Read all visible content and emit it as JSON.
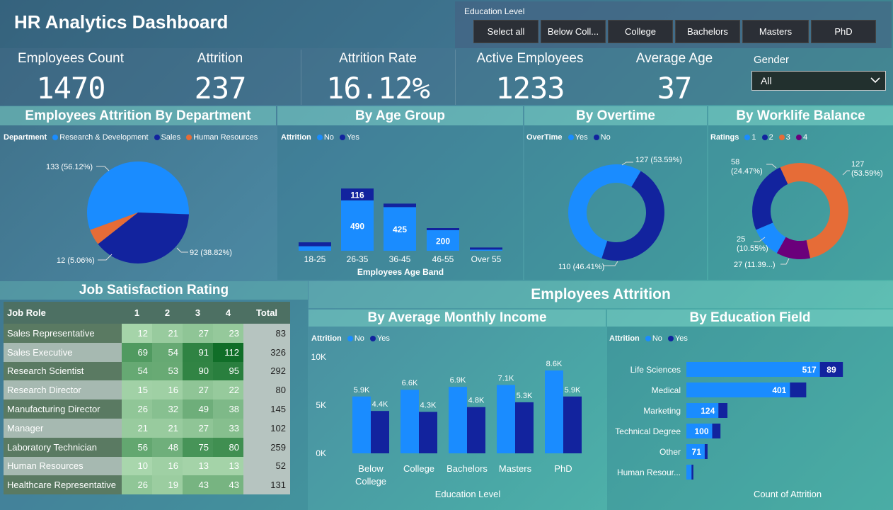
{
  "title": "HR Analytics Dashboard",
  "education_filter": {
    "label": "Education Level",
    "options": [
      "Select all",
      "Below Coll...",
      "College",
      "Bachelors",
      "Masters",
      "PhD"
    ]
  },
  "kpis": [
    {
      "label": "Employees Count",
      "value": "1470"
    },
    {
      "label": "Attrition",
      "value": "237"
    },
    {
      "label": "Attrition Rate",
      "value": "16.12%"
    },
    {
      "label": "Active Employees",
      "value": "1233"
    },
    {
      "label": "Average Age",
      "value": "37"
    }
  ],
  "gender": {
    "label": "Gender",
    "value": "All"
  },
  "headers": {
    "dept": "Employees Attrition By Department",
    "age": "By Age Group",
    "overtime": "By Overtime",
    "worklife": "By Worklife Balance",
    "jobsat": "Job Satisfaction Rating",
    "attrition": "Employees Attrition",
    "income": "By Average Monthly Income",
    "edufield": "By Education Field"
  },
  "colors": {
    "light": "#1a8cff",
    "dark": "#12239e",
    "orange": "#e66c37",
    "purple": "#6b007b"
  },
  "chart_data": [
    {
      "type": "pie",
      "legend_title": "Department",
      "categories": [
        "Research & Development",
        "Sales",
        "Human Resources"
      ],
      "values": [
        133,
        92,
        12
      ],
      "labels": [
        "133 (56.12%)",
        "92 (38.82%)",
        "12 (5.06%)"
      ]
    },
    {
      "type": "bar",
      "stacked": true,
      "legend_title": "Attrition",
      "xlabel": "Employees Age Band",
      "categories": [
        "18-25",
        "26-35",
        "36-45",
        "46-55",
        "Over 55"
      ],
      "series": [
        {
          "name": "No",
          "values": [
            44,
            490,
            425,
            200,
            11
          ]
        },
        {
          "name": "Yes",
          "values": [
            38,
            116,
            34,
            18,
            5
          ]
        }
      ],
      "data_labels": {
        "No": [
          "",
          "490",
          "425",
          "200",
          ""
        ],
        "Yes": [
          "",
          "116",
          "",
          "",
          ""
        ]
      }
    },
    {
      "type": "pie",
      "donut": true,
      "legend_title": "OverTime",
      "categories": [
        "Yes",
        "No"
      ],
      "values": [
        127,
        110
      ],
      "labels": [
        "127 (53.59%)",
        "110 (46.41%)"
      ]
    },
    {
      "type": "pie",
      "donut": true,
      "legend_title": "Ratings",
      "categories": [
        "1",
        "2",
        "3",
        "4"
      ],
      "values": [
        25,
        58,
        127,
        27
      ],
      "labels": [
        "25 (10.55%)",
        "58 (24.47%)",
        "127 (53.59%)",
        "27 (11.39...)"
      ]
    },
    {
      "type": "bar",
      "legend_title": "Attrition",
      "xlabel": "Education Level",
      "categories": [
        "Below College",
        "College",
        "Bachelors",
        "Masters",
        "PhD"
      ],
      "yticks": [
        "0K",
        "5K",
        "10K"
      ],
      "ylim": [
        0,
        10000
      ],
      "series": [
        {
          "name": "No",
          "values": [
            5900,
            6600,
            6900,
            7100,
            8600
          ],
          "labels": [
            "5.9K",
            "6.6K",
            "6.9K",
            "7.1K",
            "8.6K"
          ]
        },
        {
          "name": "Yes",
          "values": [
            4400,
            4300,
            4800,
            5300,
            5900
          ],
          "labels": [
            "4.4K",
            "4.3K",
            "4.8K",
            "5.3K",
            "5.9K"
          ]
        }
      ]
    },
    {
      "type": "bar",
      "orientation": "horizontal",
      "stacked": true,
      "legend_title": "Attrition",
      "xlabel": "Count of Attrition",
      "categories": [
        "Life Sciences",
        "Medical",
        "Marketing",
        "Technical Degree",
        "Other",
        "Human Resour..."
      ],
      "series": [
        {
          "name": "No",
          "values": [
            517,
            401,
            124,
            100,
            71,
            20
          ],
          "labels": [
            "517",
            "401",
            "124",
            "100",
            "71",
            ""
          ]
        },
        {
          "name": "Yes",
          "values": [
            89,
            63,
            35,
            32,
            11,
            7
          ],
          "labels": [
            "89",
            "",
            "",
            "",
            "",
            ""
          ]
        }
      ]
    },
    {
      "type": "table",
      "title": "Job Satisfaction Rating",
      "columns": [
        "Job Role",
        "1",
        "2",
        "3",
        "4",
        "Total"
      ],
      "rows": [
        [
          "Sales Representative",
          12,
          21,
          27,
          23,
          83
        ],
        [
          "Sales Executive",
          69,
          54,
          91,
          112,
          326
        ],
        [
          "Research Scientist",
          54,
          53,
          90,
          95,
          292
        ],
        [
          "Research Director",
          15,
          16,
          27,
          22,
          80
        ],
        [
          "Manufacturing Director",
          26,
          32,
          49,
          38,
          145
        ],
        [
          "Manager",
          21,
          21,
          27,
          33,
          102
        ],
        [
          "Laboratory Technician",
          56,
          48,
          75,
          80,
          259
        ],
        [
          "Human Resources",
          10,
          16,
          13,
          13,
          52
        ],
        [
          "Healthcare Representative",
          26,
          19,
          43,
          43,
          131
        ]
      ]
    }
  ]
}
